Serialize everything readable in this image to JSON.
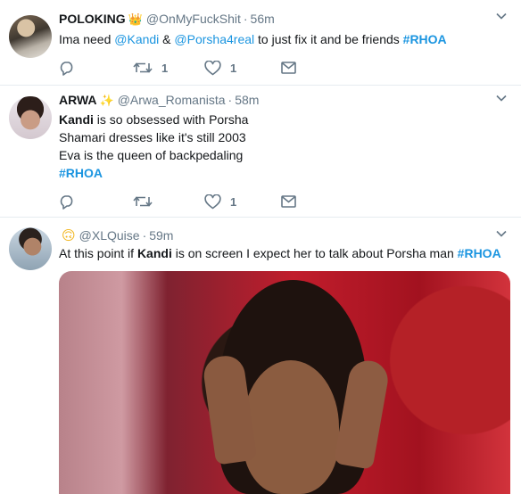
{
  "tweets": [
    {
      "name": "POLOKING",
      "badge_icon": "crown-icon",
      "badge": "👑",
      "handle": "@OnMyFuckShit",
      "time": "56m",
      "text_parts": [
        "Ima need ",
        "@Kandi",
        " & ",
        "@Porsha4real",
        " to just fix it and be friends ",
        "#RHOA"
      ],
      "actions": {
        "reply": "",
        "retweet": "1",
        "like": "1"
      }
    },
    {
      "name": "ARWA",
      "badge_icon": "sparkles-icon",
      "badge": "✨",
      "handle": "@Arwa_Romanista",
      "time": "58m",
      "lines": [
        {
          "bold": "Kandi",
          "rest": " is so obsessed with Porsha"
        },
        {
          "text": "Shamari dresses like it's still 2003"
        },
        {
          "text": "Eva is the queen of backpedaling"
        },
        {
          "hashtag": "#RHOA"
        }
      ],
      "actions": {
        "reply": "",
        "retweet": "",
        "like": "1"
      }
    },
    {
      "name": "",
      "badge_icon": "upside-down-face-icon",
      "badge": "🙃",
      "handle": "@XLQuise",
      "time": "59m",
      "text_parts": [
        "At this point if ",
        "Kandi",
        " is on screen I expect her to talk about Porsha man ",
        "#RHOA"
      ],
      "media": "gif-still"
    }
  ],
  "dot": "·",
  "colors": {
    "link": "#1b95e0",
    "muted": "#657786",
    "divider": "#e6ecf0"
  }
}
